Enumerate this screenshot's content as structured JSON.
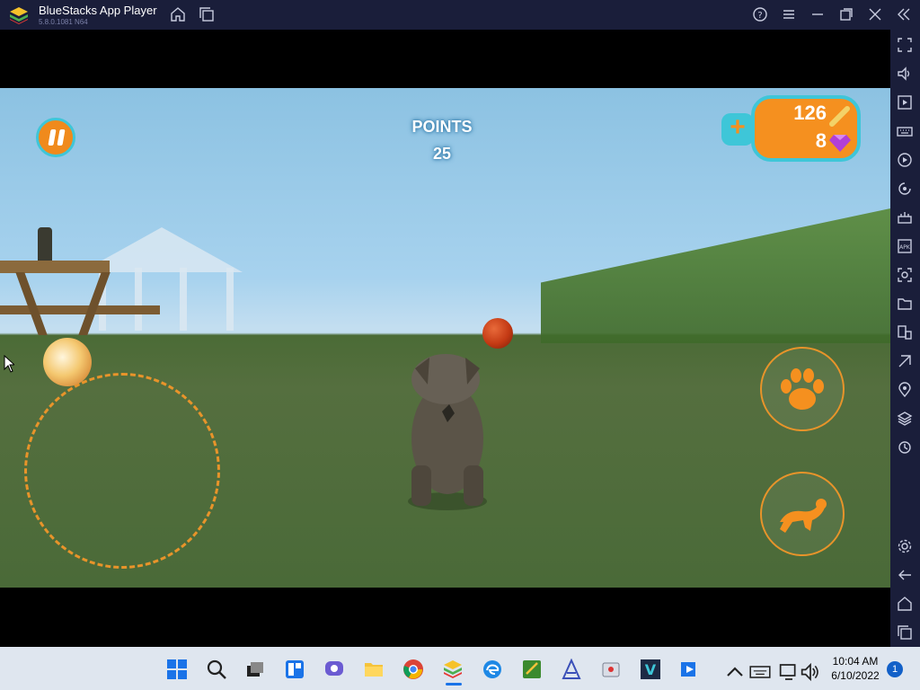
{
  "window": {
    "title": "BlueStacks App Player",
    "version": "5.8.0.1081 N64"
  },
  "titlebar_icons": [
    "home-icon",
    "multi-instance-icon",
    "help-icon",
    "menu-icon",
    "minimize-icon",
    "restore-icon",
    "close-icon",
    "collapse-sidebar-icon"
  ],
  "sidebar_icons": [
    "fullscreen-icon",
    "volume-icon",
    "media-icon",
    "keyboard-icon",
    "macro-icon",
    "sync-icon",
    "game-controls-icon",
    "install-apk-icon",
    "screenshot-icon",
    "folder-icon",
    "multi-screen-icon",
    "eco-mode-icon",
    "location-icon",
    "layers-icon",
    "rotate-icon",
    "settings-icon",
    "back-icon",
    "home-icon",
    "recents-icon"
  ],
  "game": {
    "points_label": "POINTS",
    "points_value": "25",
    "coins": "126",
    "gems": "8"
  },
  "taskbar": {
    "time": "10:04 AM",
    "date": "6/10/2022",
    "notifications": "1",
    "apps": [
      "start-icon",
      "search-icon",
      "task-view-icon",
      "widgets-icon",
      "chat-icon",
      "file-explorer-icon",
      "chrome-icon",
      "bluestacks-icon",
      "edge-icon",
      "app-store-icon",
      "vector-app-icon",
      "tool-icon",
      "v-app-icon",
      "media-player-icon"
    ]
  },
  "colors": {
    "titlebar": "#1a1e3a",
    "accent_orange": "#f5901f",
    "accent_cyan": "#3ec6d8",
    "taskbar": "#dfe6ef"
  }
}
